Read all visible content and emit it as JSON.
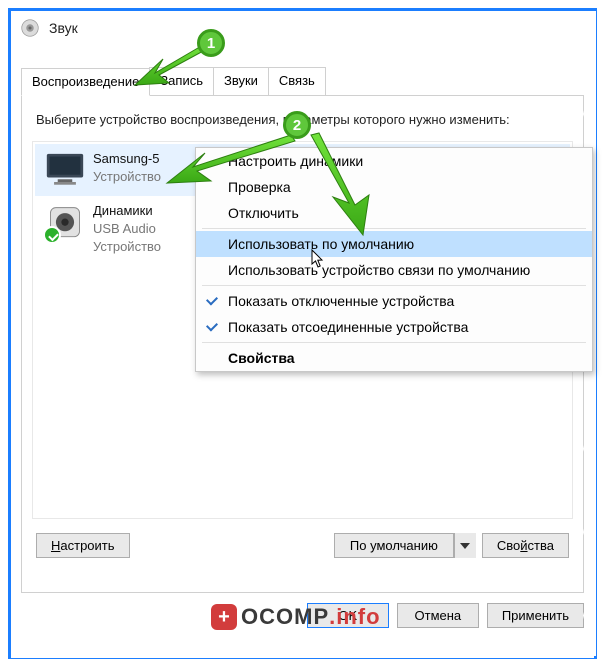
{
  "title": "Звук",
  "tabs": {
    "playback": "Воспроизведение",
    "recording": "Запись",
    "sounds": "Звуки",
    "comm": "Связь"
  },
  "instruction": "Выберите устройство воспроизведения, параметры которого нужно изменить:",
  "devices": [
    {
      "name": "Samsung-5",
      "sub1": "Устройство"
    },
    {
      "name": "Динамики",
      "sub1": "USB Audio",
      "sub2": "Устройство"
    }
  ],
  "configure_btn": "Настроить",
  "default_btn": "По умолчанию",
  "properties_btn": "Свойства",
  "footer": {
    "ok": "OK",
    "cancel": "Отмена",
    "apply": "Применить"
  },
  "context_menu": {
    "configure": "Настроить динамики",
    "test": "Проверка",
    "disable": "Отключить",
    "set_default": "Использовать по умолчанию",
    "set_comm_default": "Использовать устройство связи по умолчанию",
    "show_disabled": "Показать отключенные устройства",
    "show_disconnected": "Показать отсоединенные устройства",
    "properties": "Свойства"
  },
  "markers": {
    "one": "1",
    "two": "2"
  },
  "watermark": {
    "text1": "OCOMP",
    "text2": ".info"
  }
}
